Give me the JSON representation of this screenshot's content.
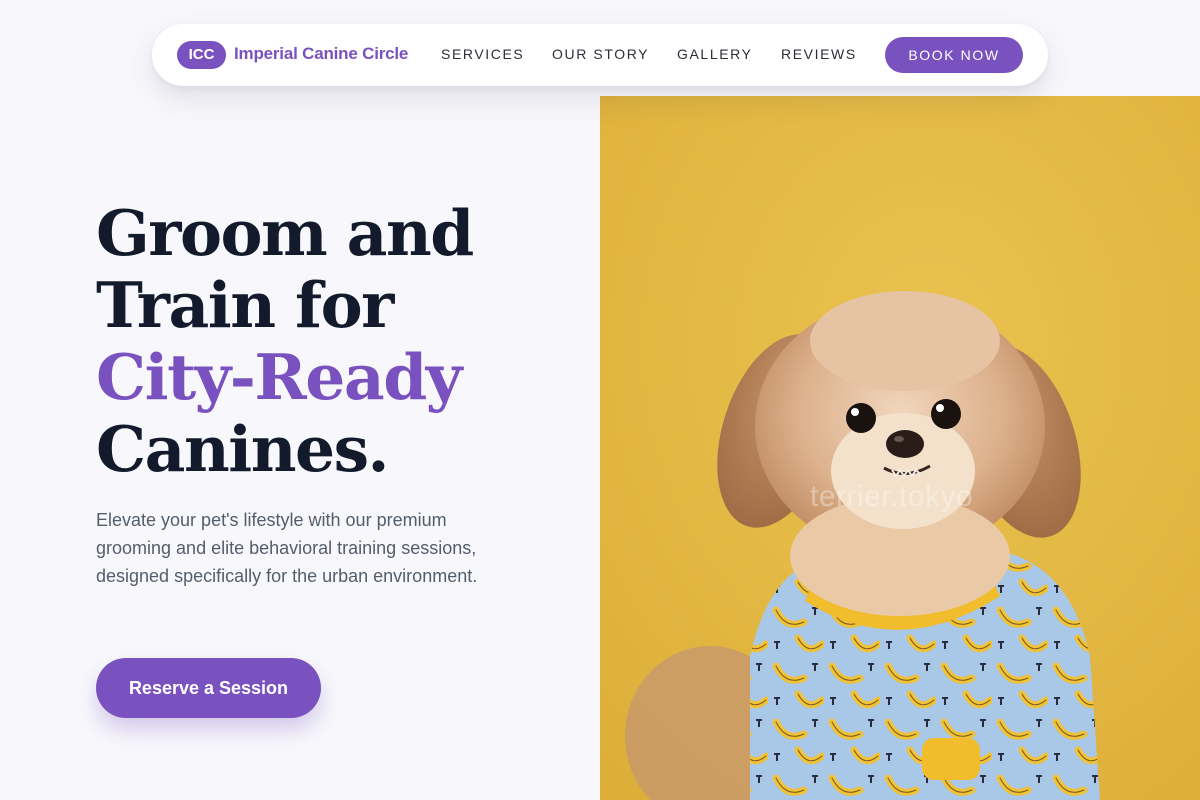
{
  "nav": {
    "logo_badge": "ICC",
    "brand_name": "Imperial Canine Circle",
    "links": [
      {
        "label": "SERVICES"
      },
      {
        "label": "OUR STORY"
      },
      {
        "label": "GALLERY"
      },
      {
        "label": "REVIEWS"
      }
    ],
    "cta_label": "BOOK NOW"
  },
  "hero": {
    "headline_line1": "Groom and",
    "headline_line2": "Train for",
    "headline_accent": "City-Ready",
    "headline_line4": "Canines.",
    "description": "Elevate your pet's lifestyle with our premium grooming and elite behavioral training sessions, designed specifically for the urban environment.",
    "cta_label": "Reserve a Session"
  },
  "photo": {
    "subject": "small-dog-in-banana-pajamas",
    "watermark": "terrier.tokyo"
  },
  "colors": {
    "accent": "#7a52c0",
    "heading": "#121a2b",
    "body_text": "#545d6b",
    "page_bg": "#f8f8fc",
    "photo_bg": "#e3b63d"
  }
}
